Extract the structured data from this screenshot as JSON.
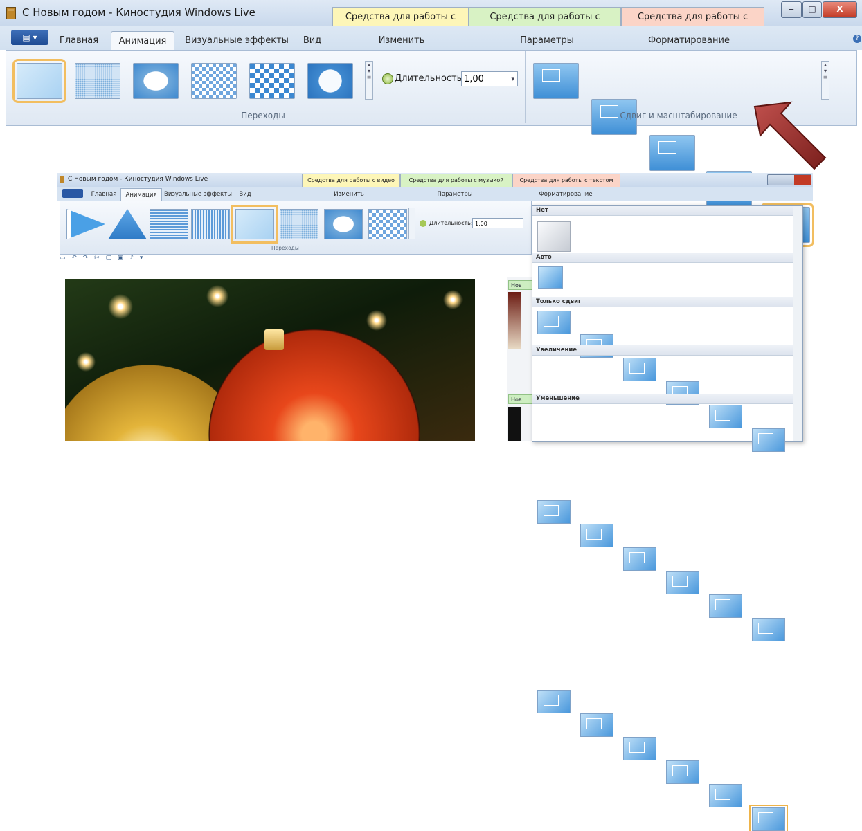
{
  "top": {
    "window_title": "С Новым годом - Киностудия Windows Live",
    "context_tabs": [
      {
        "label": "Средства для работы с видео",
        "color": "#fdf6b8"
      },
      {
        "label": "Средства для работы с музыкой",
        "color": "#d8f2c4"
      },
      {
        "label": "Средства для работы с текстом",
        "color": "#fbd4c7"
      }
    ],
    "window_buttons": {
      "minimize": "‒",
      "maximize": "□",
      "close": "X"
    },
    "file_menu_glyph": "▤ ▾",
    "tabs": [
      "Главная",
      "Анимация",
      "Визуальные эффекты",
      "Вид"
    ],
    "context_subtabs": [
      "Изменить",
      "Параметры",
      "Форматирование"
    ],
    "active_tab": "Анимация",
    "help_glyph": "?",
    "transitions_label": "Переходы",
    "pan_zoom_label": "Сдвиг и масштабирование",
    "duration_label": "Длительность:",
    "duration_value": "1,00"
  },
  "bottom": {
    "window_title": "С Новым годом - Киностудия Windows Live",
    "context_tabs": [
      "Средства для работы с видео",
      "Средства для работы с музыкой",
      "Средства для работы с текстом"
    ],
    "tabs": [
      "Главная",
      "Анимация",
      "Визуальные эффекты",
      "Вид"
    ],
    "context_subtabs": [
      "Изменить",
      "Параметры",
      "Форматирование"
    ],
    "duration_label": "Длительность:",
    "duration_value": "1,00",
    "transitions_label": "Переходы",
    "film_labels": [
      "Нов",
      "Нов"
    ],
    "gallery": {
      "sections": [
        "Нет",
        "Авто",
        "Только сдвиг",
        "Увеличение",
        "Уменьшение"
      ]
    }
  }
}
